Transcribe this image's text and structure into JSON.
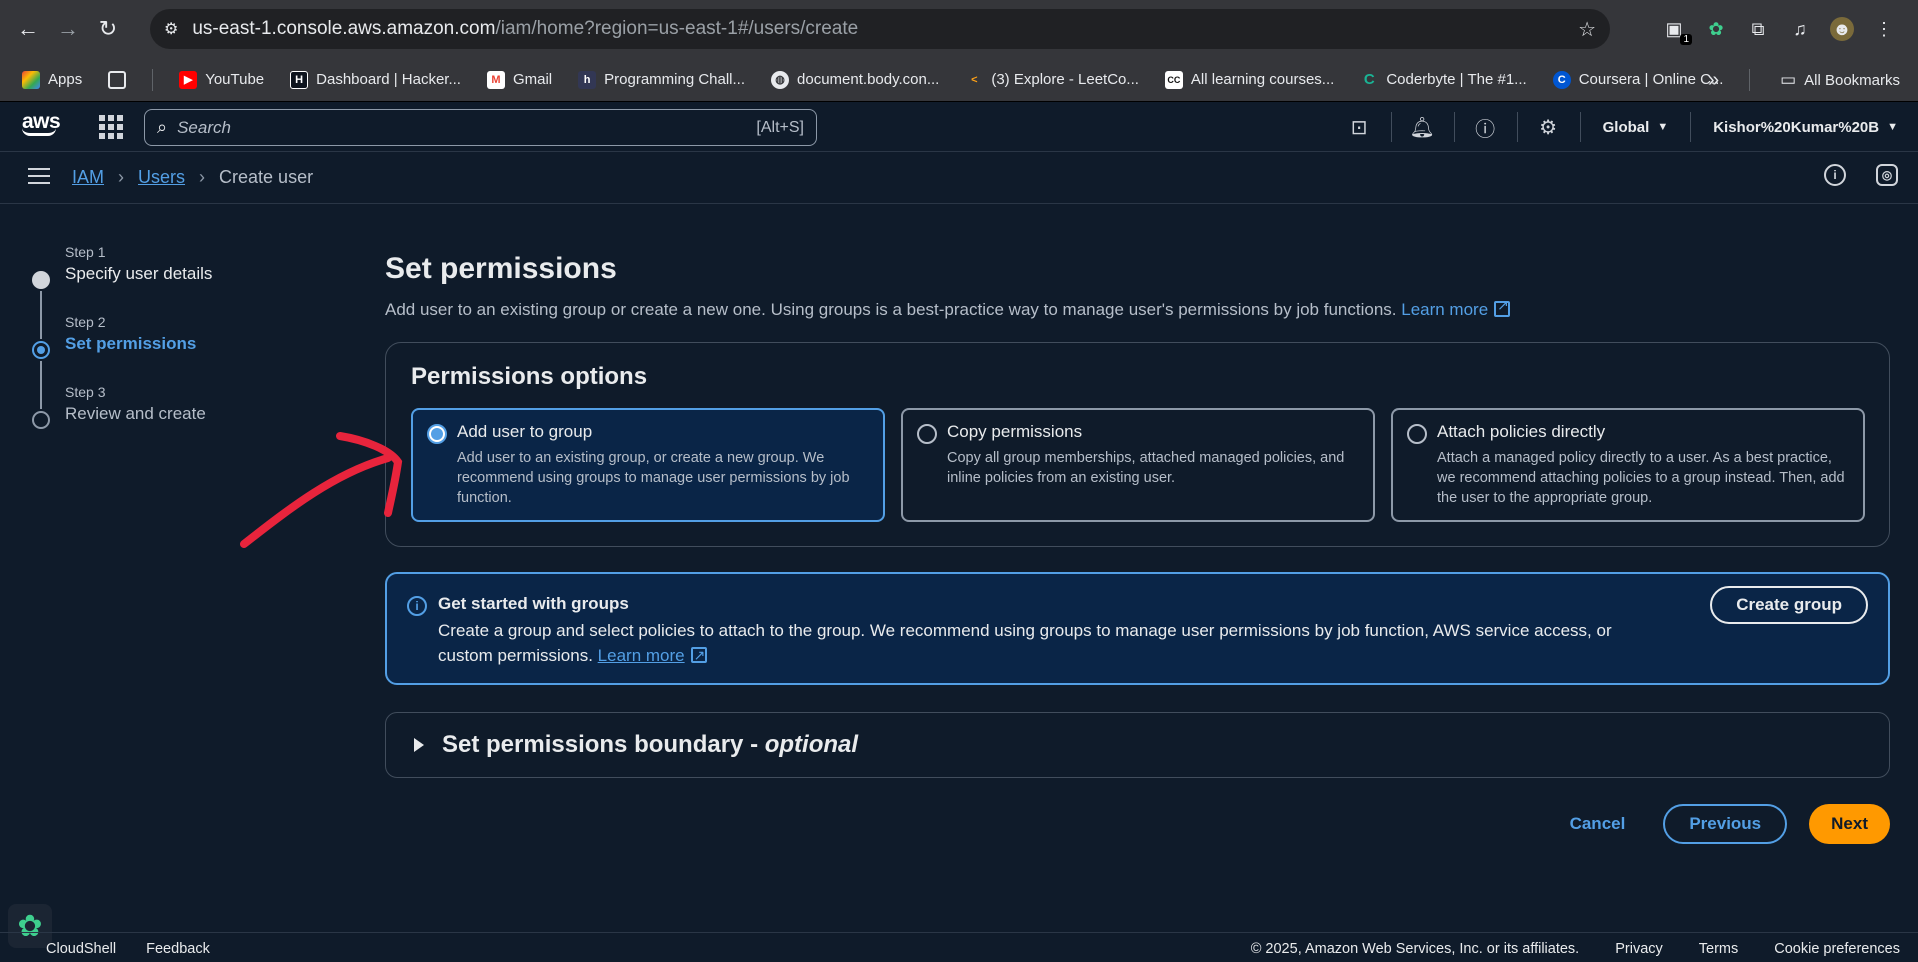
{
  "browser": {
    "url_host": "us-east-1.console.aws.amazon.com",
    "url_path": "/iam/home?region=us-east-1#/users/create",
    "extension_badge": "1"
  },
  "bookmarks": {
    "items": [
      {
        "label": "Apps",
        "icon": "apps-grid-icon",
        "color": "#ea4335"
      },
      {
        "label": "YouTube",
        "icon": "youtube-icon",
        "color": "#ff0000"
      },
      {
        "label": "Dashboard | Hacker...",
        "icon": "hackerrank-icon",
        "color": "#1ba94c"
      },
      {
        "label": "Gmail",
        "icon": "gmail-icon",
        "color": "#ea4335"
      },
      {
        "label": "Programming Chall...",
        "icon": "hackerearth-icon",
        "color": "#323754"
      },
      {
        "label": "document.body.con...",
        "icon": "globe-icon",
        "color": "#5f6368"
      },
      {
        "label": "(3) Explore - LeetCo...",
        "icon": "leetcode-icon",
        "color": "#ffa116"
      },
      {
        "label": "All learning courses...",
        "icon": "codecademy-icon",
        "color": "#3a3a3a"
      },
      {
        "label": "Coderbyte | The #1...",
        "icon": "coderbyte-icon",
        "color": "#1ab394"
      },
      {
        "label": "Coursera | Online C...",
        "icon": "coursera-icon",
        "color": "#0056d2"
      }
    ],
    "overflow": "»",
    "all_bookmarks": "All Bookmarks"
  },
  "aws_header": {
    "logo": "aws",
    "search_placeholder": "Search",
    "search_shortcut": "[Alt+S]",
    "region": "Global",
    "account": "Kishor%20Kumar%20B"
  },
  "breadcrumb": {
    "items": [
      "IAM",
      "Users"
    ],
    "current": "Create user"
  },
  "steps": [
    {
      "number": "Step 1",
      "title": "Specify user details"
    },
    {
      "number": "Step 2",
      "title": "Set permissions"
    },
    {
      "number": "Step 3",
      "title": "Review and create"
    }
  ],
  "main": {
    "title": "Set permissions",
    "description": "Add user to an existing group or create a new one. Using groups is a best-practice way to manage user's permissions by job functions.",
    "learn_more": "Learn more",
    "permissions_options_title": "Permissions options",
    "options": [
      {
        "title": "Add user to group",
        "desc": "Add user to an existing group, or create a new group. We recommend using groups to manage user permissions by job function."
      },
      {
        "title": "Copy permissions",
        "desc": "Copy all group memberships, attached managed policies, and inline policies from an existing user."
      },
      {
        "title": "Attach policies directly",
        "desc": "Attach a managed policy directly to a user. As a best practice, we recommend attaching policies to a group instead. Then, add the user to the appropriate group."
      }
    ],
    "info": {
      "title": "Get started with groups",
      "text": "Create a group and select policies to attach to the group. We recommend using groups to manage user permissions by job function, AWS service access, or custom permissions.",
      "learn_more": "Learn more",
      "button": "Create group"
    },
    "boundary": {
      "title": "Set permissions boundary - ",
      "optional": "optional"
    },
    "actions": {
      "cancel": "Cancel",
      "previous": "Previous",
      "next": "Next"
    }
  },
  "footer": {
    "cloudshell": "CloudShell",
    "feedback": "Feedback",
    "copyright": "© 2025, Amazon Web Services, Inc. or its affiliates.",
    "privacy": "Privacy",
    "terms": "Terms",
    "cookie": "Cookie preferences"
  },
  "colors": {
    "accent": "#539fe5",
    "primary_button": "#ff9900",
    "annotation_arrow": "#e8243c"
  }
}
